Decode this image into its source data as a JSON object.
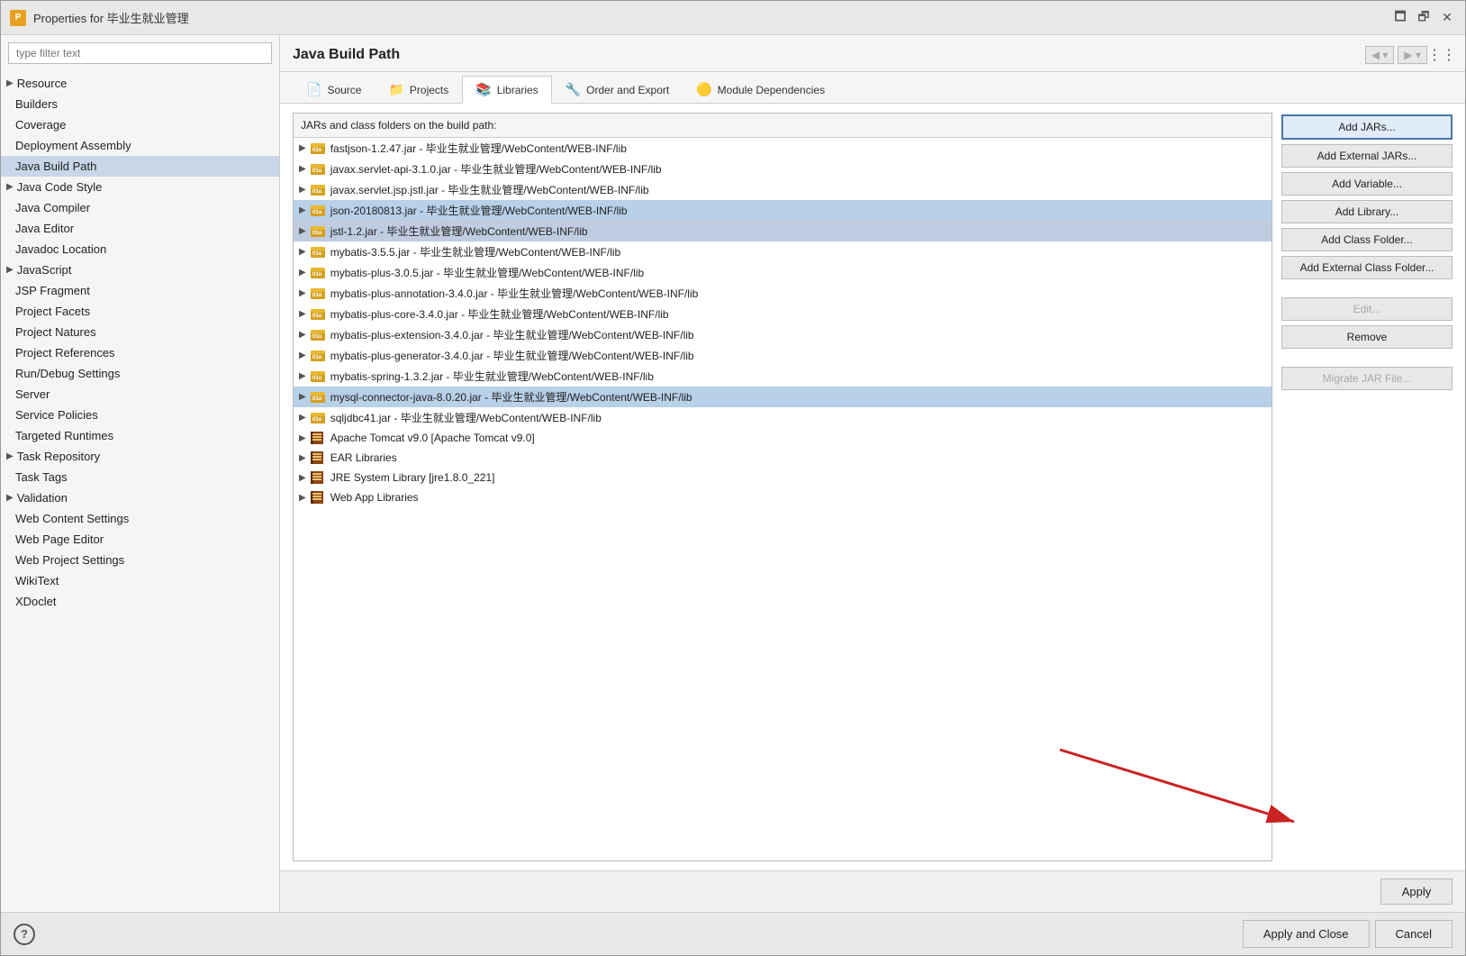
{
  "window": {
    "title": "Properties for 毕业生就业管理",
    "icon": "P",
    "minimize_label": "🗖",
    "maximize_label": "🗗",
    "close_label": "✕"
  },
  "sidebar": {
    "filter_placeholder": "type filter text",
    "items": [
      {
        "label": "Resource",
        "has_arrow": true,
        "selected": false
      },
      {
        "label": "Builders",
        "has_arrow": false,
        "selected": false
      },
      {
        "label": "Coverage",
        "has_arrow": false,
        "selected": false
      },
      {
        "label": "Deployment Assembly",
        "has_arrow": false,
        "selected": false
      },
      {
        "label": "Java Build Path",
        "has_arrow": false,
        "selected": true
      },
      {
        "label": "Java Code Style",
        "has_arrow": true,
        "selected": false
      },
      {
        "label": "Java Compiler",
        "has_arrow": false,
        "selected": false
      },
      {
        "label": "Java Editor",
        "has_arrow": false,
        "selected": false
      },
      {
        "label": "Javadoc Location",
        "has_arrow": false,
        "selected": false
      },
      {
        "label": "JavaScript",
        "has_arrow": true,
        "selected": false
      },
      {
        "label": "JSP Fragment",
        "has_arrow": false,
        "selected": false
      },
      {
        "label": "Project Facets",
        "has_arrow": false,
        "selected": false
      },
      {
        "label": "Project Natures",
        "has_arrow": false,
        "selected": false
      },
      {
        "label": "Project References",
        "has_arrow": false,
        "selected": false
      },
      {
        "label": "Run/Debug Settings",
        "has_arrow": false,
        "selected": false
      },
      {
        "label": "Server",
        "has_arrow": false,
        "selected": false
      },
      {
        "label": "Service Policies",
        "has_arrow": false,
        "selected": false
      },
      {
        "label": "Targeted Runtimes",
        "has_arrow": false,
        "selected": false
      },
      {
        "label": "Task Repository",
        "has_arrow": true,
        "selected": false
      },
      {
        "label": "Task Tags",
        "has_arrow": false,
        "selected": false
      },
      {
        "label": "Validation",
        "has_arrow": true,
        "selected": false
      },
      {
        "label": "Web Content Settings",
        "has_arrow": false,
        "selected": false
      },
      {
        "label": "Web Page Editor",
        "has_arrow": false,
        "selected": false
      },
      {
        "label": "Web Project Settings",
        "has_arrow": false,
        "selected": false
      },
      {
        "label": "WikiText",
        "has_arrow": false,
        "selected": false
      },
      {
        "label": "XDoclet",
        "has_arrow": false,
        "selected": false
      }
    ]
  },
  "panel": {
    "title": "Java Build Path",
    "back_label": "◀",
    "forward_label": "▶",
    "menu_label": "⋮",
    "description": "JARs and class folders on the build path:"
  },
  "tabs": [
    {
      "label": "Source",
      "icon": "📄",
      "active": false
    },
    {
      "label": "Projects",
      "icon": "📁",
      "active": false
    },
    {
      "label": "Libraries",
      "icon": "📚",
      "active": true
    },
    {
      "label": "Order and Export",
      "icon": "🔧",
      "active": false
    },
    {
      "label": "Module Dependencies",
      "icon": "🟡",
      "active": false
    }
  ],
  "jar_items": [
    {
      "label": "fastjson-1.2.47.jar - 毕业生就业管理/WebContent/WEB-INF/lib",
      "selected": false,
      "type": "jar"
    },
    {
      "label": "javax.servlet-api-3.1.0.jar - 毕业生就业管理/WebContent/WEB-INF/lib",
      "selected": false,
      "type": "jar"
    },
    {
      "label": "javax.servlet.jsp.jstl.jar - 毕业生就业管理/WebContent/WEB-INF/lib",
      "selected": false,
      "type": "jar"
    },
    {
      "label": "json-20180813.jar - 毕业生就业管理/WebContent/WEB-INF/lib",
      "selected": true,
      "type": "jar"
    },
    {
      "label": "jstl-1.2.jar - 毕业生就业管理/WebContent/WEB-INF/lib",
      "selected": true,
      "type": "jar"
    },
    {
      "label": "mybatis-3.5.5.jar - 毕业生就业管理/WebContent/WEB-INF/lib",
      "selected": false,
      "type": "jar"
    },
    {
      "label": "mybatis-plus-3.0.5.jar - 毕业生就业管理/WebContent/WEB-INF/lib",
      "selected": false,
      "type": "jar"
    },
    {
      "label": "mybatis-plus-annotation-3.4.0.jar - 毕业生就业管理/WebContent/WEB-INF/lib",
      "selected": false,
      "type": "jar"
    },
    {
      "label": "mybatis-plus-core-3.4.0.jar - 毕业生就业管理/WebContent/WEB-INF/lib",
      "selected": false,
      "type": "jar"
    },
    {
      "label": "mybatis-plus-extension-3.4.0.jar - 毕业生就业管理/WebContent/WEB-INF/lib",
      "selected": false,
      "type": "jar"
    },
    {
      "label": "mybatis-plus-generator-3.4.0.jar - 毕业生就业管理/WebContent/WEB-INF/lib",
      "selected": false,
      "type": "jar"
    },
    {
      "label": "mybatis-spring-1.3.2.jar - 毕业生就业管理/WebContent/WEB-INF/lib",
      "selected": false,
      "type": "jar"
    },
    {
      "label": "mysql-connector-java-8.0.20.jar - 毕业生就业管理/WebContent/WEB-INF/lib",
      "selected": true,
      "type": "jar"
    },
    {
      "label": "sqljdbc41.jar - 毕业生就业管理/WebContent/WEB-INF/lib",
      "selected": false,
      "type": "jar"
    },
    {
      "label": "Apache Tomcat v9.0 [Apache Tomcat v9.0]",
      "selected": false,
      "type": "lib"
    },
    {
      "label": "EAR Libraries",
      "selected": false,
      "type": "lib"
    },
    {
      "label": "JRE System Library [jre1.8.0_221]",
      "selected": false,
      "type": "lib"
    },
    {
      "label": "Web App Libraries",
      "selected": false,
      "type": "lib"
    }
  ],
  "action_buttons": [
    {
      "label": "Add JARs...",
      "primary": true,
      "disabled": false
    },
    {
      "label": "Add External JARs...",
      "primary": false,
      "disabled": false
    },
    {
      "label": "Add Variable...",
      "primary": false,
      "disabled": false
    },
    {
      "label": "Add Library...",
      "primary": false,
      "disabled": false
    },
    {
      "label": "Add Class Folder...",
      "primary": false,
      "disabled": false
    },
    {
      "label": "Add External Class Folder...",
      "primary": false,
      "disabled": false
    },
    {
      "label": "Edit...",
      "primary": false,
      "disabled": true
    },
    {
      "label": "Remove",
      "primary": false,
      "disabled": false
    },
    {
      "label": "Migrate JAR File...",
      "primary": false,
      "disabled": true
    }
  ],
  "bottom_buttons": {
    "apply_label": "Apply"
  },
  "footer_buttons": {
    "apply_close_label": "Apply and Close",
    "cancel_label": "Cancel",
    "help_label": "?"
  }
}
